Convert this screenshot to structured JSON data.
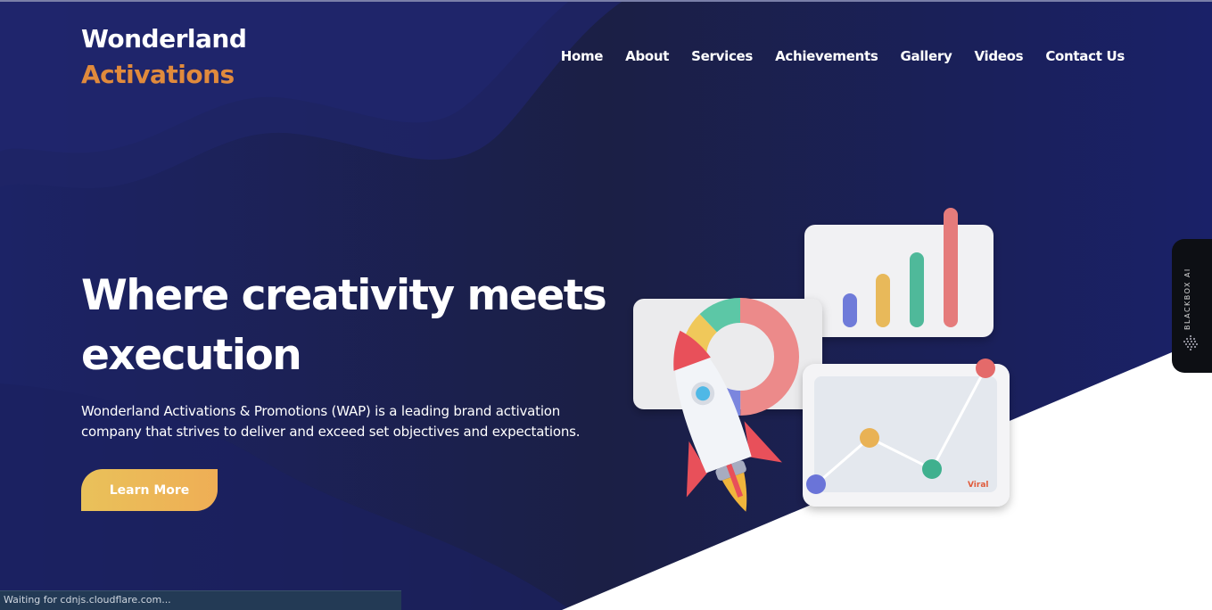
{
  "logo": {
    "line1": "Wonderland",
    "line2": "Activations"
  },
  "nav": {
    "items": [
      "Home",
      "About",
      "Services",
      "Achievements",
      "Gallery",
      "Videos",
      "Contact Us"
    ]
  },
  "hero": {
    "title": "Where creativity meets execution",
    "description": "Wonderland Activations & Promotions (WAP) is a leading brand activation company that strives to deliver and exceed set objectives and expectations.",
    "cta_label": "Learn More"
  },
  "illustration": {
    "brand_mark": "Viral"
  },
  "blackbox": {
    "label": "BLACKBOX AI"
  },
  "status_bar": {
    "text": "Waiting for cdnjs.cloudflare.com..."
  },
  "colors": {
    "background": "#1a1f5a",
    "accent_orange": "#e08a3c",
    "button_gradient_start": "#e9c15a",
    "button_gradient_end": "#efae55"
  }
}
